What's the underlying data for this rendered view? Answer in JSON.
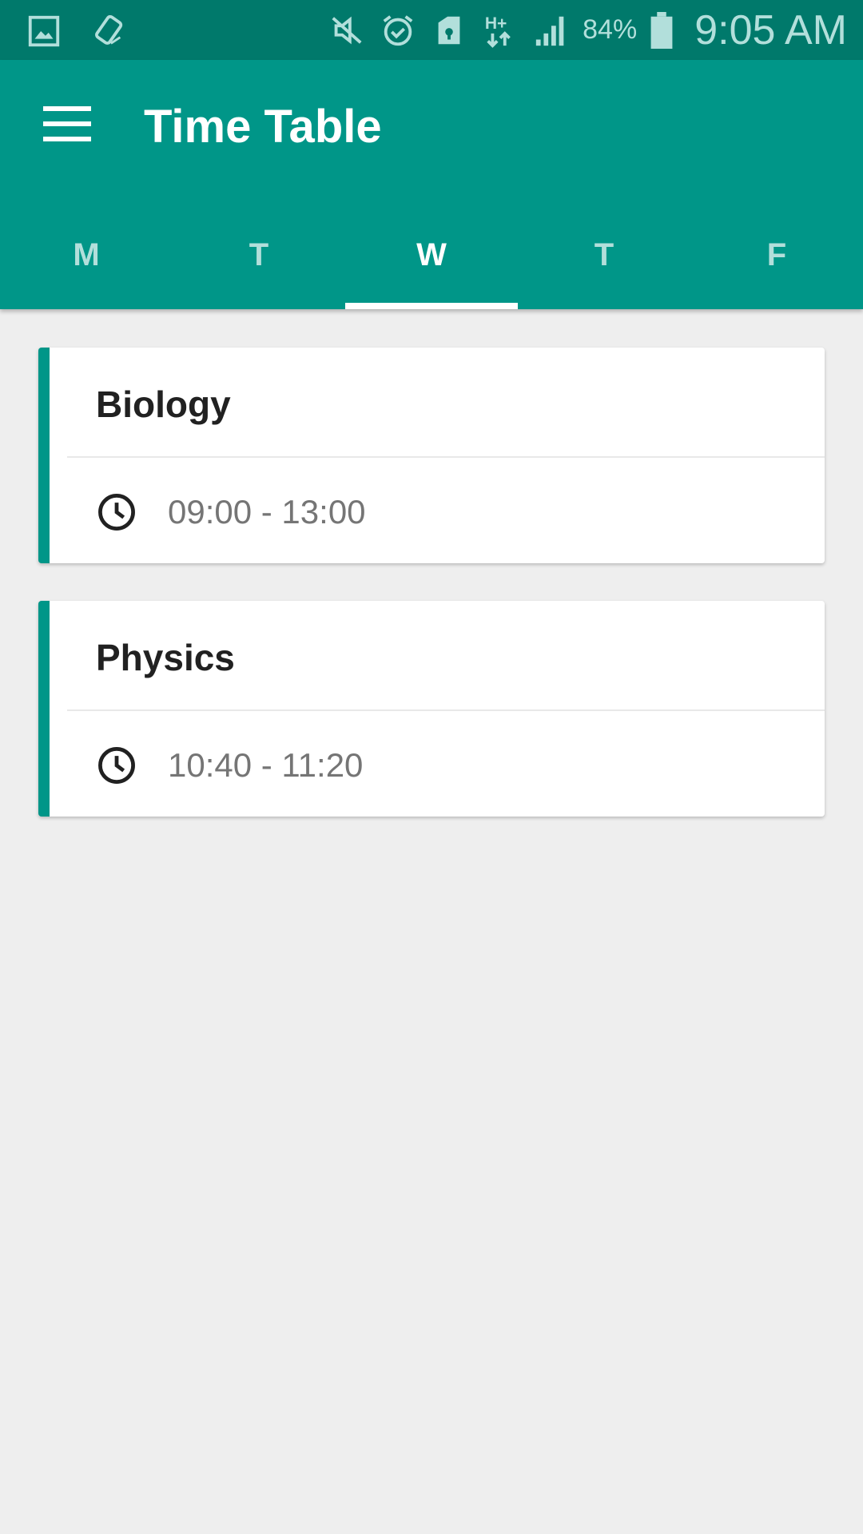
{
  "status_bar": {
    "battery_percent": "84%",
    "time": "9:05 AM",
    "icons": [
      "gallery-icon",
      "rotate-icon",
      "mute-icon",
      "alarm-icon",
      "sim-lock-icon",
      "hplus-icon",
      "signal-icon",
      "battery-icon"
    ]
  },
  "app_bar": {
    "title": "Time Table",
    "menu_icon": "hamburger-menu-icon",
    "background": "#009688"
  },
  "tabs": [
    {
      "label": "M",
      "active": false
    },
    {
      "label": "T",
      "active": false
    },
    {
      "label": "W",
      "active": true
    },
    {
      "label": "T",
      "active": false
    },
    {
      "label": "F",
      "active": false
    }
  ],
  "classes": [
    {
      "subject": "Biology",
      "time": "09:00 - 13:00"
    },
    {
      "subject": "Physics",
      "time": "10:40 - 11:20"
    }
  ],
  "colors": {
    "primary": "#009688",
    "primary_dark": "#00796b",
    "accent_indicator": "#ffffff"
  }
}
